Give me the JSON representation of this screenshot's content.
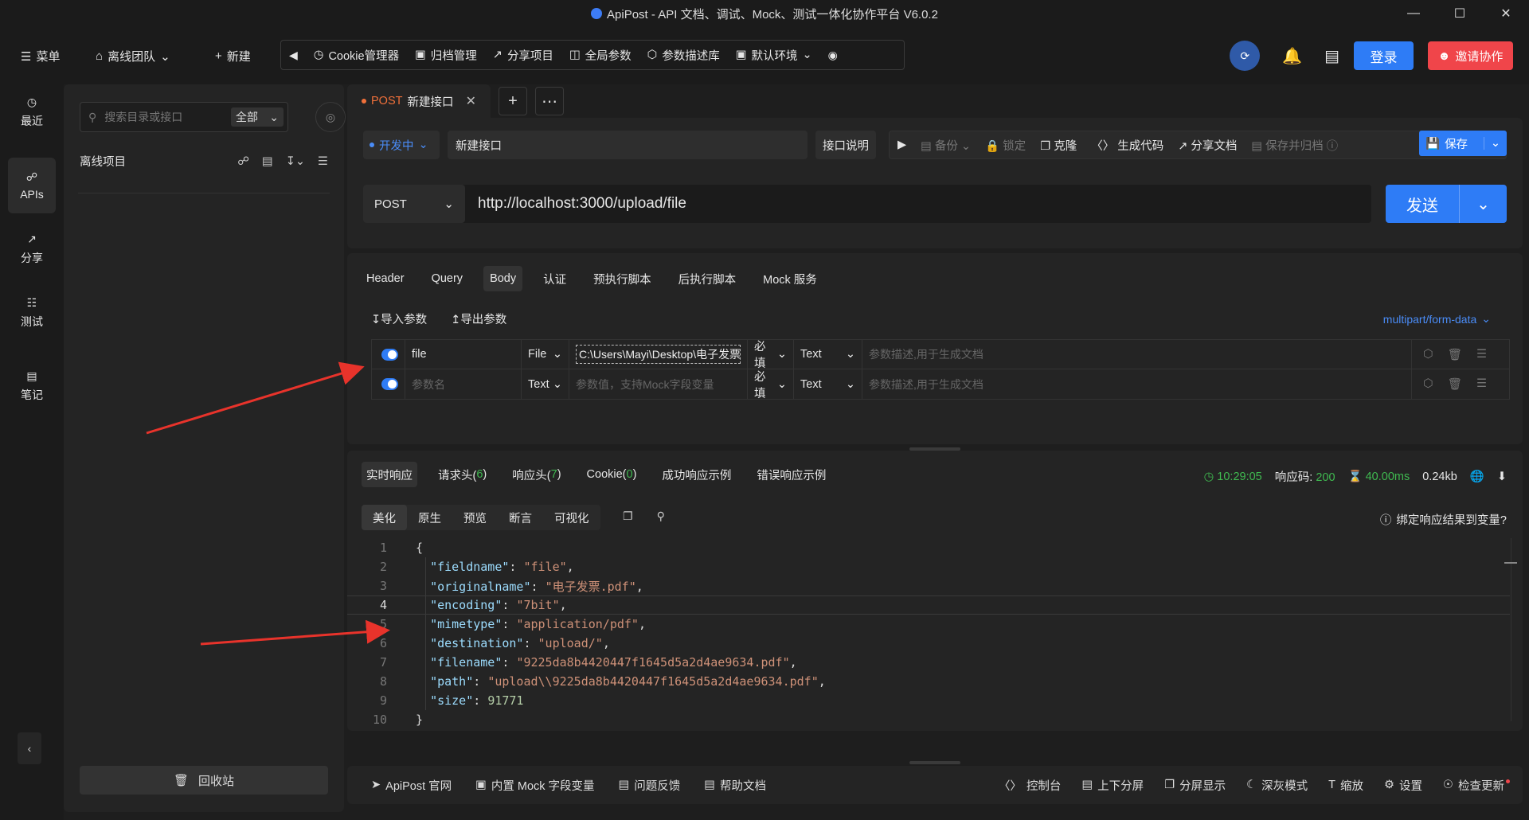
{
  "window": {
    "title": "ApiPost - API 文档、调试、Mock、测试一体化协作平台 V6.0.2"
  },
  "topbar": {
    "menu": "菜单",
    "team": "离线团队",
    "new": "新建",
    "tools": [
      "Cookie管理器",
      "归档管理",
      "分享项目",
      "全局参数",
      "参数描述库",
      "默认环境"
    ],
    "login": "登录",
    "invite": "邀请协作"
  },
  "rail": {
    "items": [
      "最近",
      "APIs",
      "分享",
      "测试",
      "笔记"
    ]
  },
  "tree": {
    "search_placeholder": "搜索目录或接口",
    "filter": "全部",
    "project": "离线项目",
    "recycle": "回收站"
  },
  "tabs": [
    {
      "method": "POST",
      "name": "新建接口"
    }
  ],
  "request": {
    "status": "开发中",
    "name": "新建接口",
    "doc_btn": "接口说明",
    "actions": {
      "backup": "备份",
      "lock": "锁定",
      "clone": "克隆",
      "gen_code": "生成代码",
      "share_doc": "分享文档",
      "save_archive": "保存并归档"
    },
    "save": "保存",
    "method": "POST",
    "url": "http://localhost:3000/upload/file",
    "send": "发送"
  },
  "params": {
    "tabs": [
      "Header",
      "Query",
      "Body",
      "认证",
      "预执行脚本",
      "后执行脚本",
      "Mock 服务"
    ],
    "active_tab": "Body",
    "import": "导入参数",
    "export": "导出参数",
    "content_type": "multipart/form-data",
    "rows": [
      {
        "key": "file",
        "type": "File",
        "value": "C:\\Users\\Mayi\\Desktop\\电子发票.pdf",
        "required": "必填",
        "vtype": "Text",
        "desc_placeholder": "参数描述,用于生成文档"
      },
      {
        "key_placeholder": "参数名",
        "type": "Text",
        "value_placeholder": "参数值，支持Mock字段变量",
        "required": "必填",
        "vtype": "Text",
        "desc_placeholder": "参数描述,用于生成文档"
      }
    ]
  },
  "response": {
    "tabs": [
      {
        "label": "实时响应"
      },
      {
        "label": "请求头(",
        "count": "6",
        "suffix": ")"
      },
      {
        "label": "响应头(",
        "count": "7",
        "suffix": ")"
      },
      {
        "label": "Cookie(",
        "count": "0",
        "suffix": ")"
      },
      {
        "label": "成功响应示例"
      },
      {
        "label": "错误响应示例"
      }
    ],
    "time": "10:29:05",
    "code_label": "响应码:",
    "code": "200",
    "duration": "40.00ms",
    "size": "0.24kb",
    "views": [
      "美化",
      "原生",
      "预览",
      "断言",
      "可视化"
    ],
    "bind_var": "绑定响应结果到变量?",
    "body_lines": [
      {
        "n": "1",
        "key": "",
        "val": "",
        "raw": "{"
      },
      {
        "n": "2",
        "key": "fieldname",
        "val": "\"file\"",
        "vtype": "s",
        "comma": ","
      },
      {
        "n": "3",
        "key": "originalname",
        "val": "\"电子发票.pdf\"",
        "vtype": "s",
        "comma": ","
      },
      {
        "n": "4",
        "key": "encoding",
        "val": "\"7bit\"",
        "vtype": "s",
        "comma": ","
      },
      {
        "n": "5",
        "key": "mimetype",
        "val": "\"application/pdf\"",
        "vtype": "s",
        "comma": ","
      },
      {
        "n": "6",
        "key": "destination",
        "val": "\"upload/\"",
        "vtype": "s",
        "comma": ","
      },
      {
        "n": "7",
        "key": "filename",
        "val": "\"9225da8b4420447f1645d5a2d4ae9634.pdf\"",
        "vtype": "s",
        "comma": ","
      },
      {
        "n": "8",
        "key": "path",
        "val": "\"upload\\\\9225da8b4420447f1645d5a2d4ae9634.pdf\"",
        "vtype": "s",
        "comma": ","
      },
      {
        "n": "9",
        "key": "size",
        "val": "91771",
        "vtype": "n",
        "comma": ""
      },
      {
        "n": "10",
        "key": "",
        "val": "",
        "raw": "}"
      }
    ]
  },
  "statusbar": {
    "left": [
      "ApiPost 官网",
      "内置 Mock 字段变量",
      "问题反馈",
      "帮助文档"
    ],
    "right": [
      "控制台",
      "上下分屏",
      "分屏显示",
      "深灰模式",
      "缩放",
      "设置",
      "检查更新"
    ]
  },
  "colors": {
    "accent": "#2e7cf6",
    "danger": "#f0454a",
    "success": "#3fb950",
    "post": "#f0703a"
  }
}
